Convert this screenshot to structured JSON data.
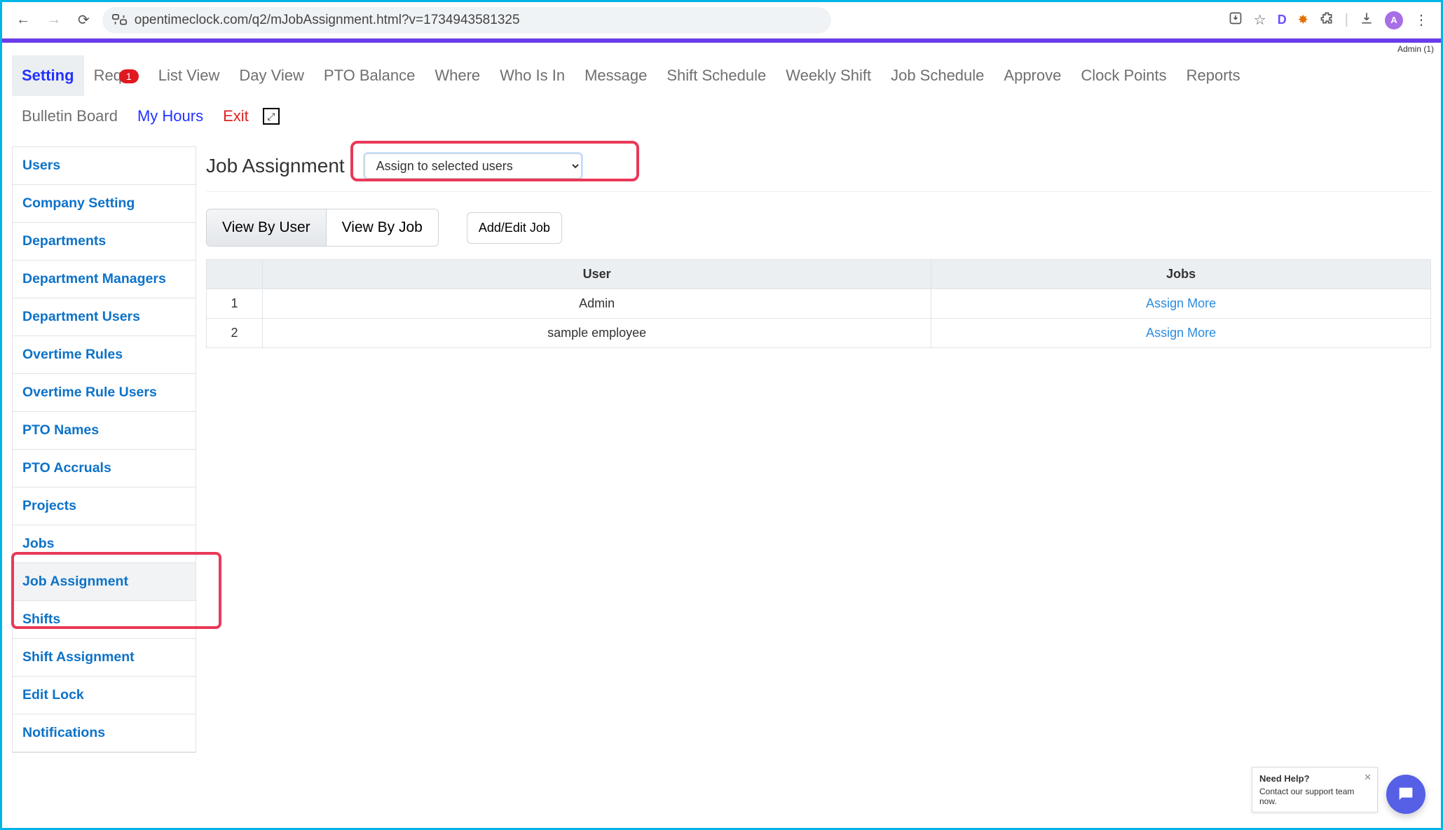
{
  "browser": {
    "url": "opentimeclock.com/q2/mJobAssignment.html?v=1734943581325",
    "avatar_letter": "A"
  },
  "header": {
    "admin_text": "Admin (1)"
  },
  "topnav": {
    "row1": [
      {
        "label": "Setting",
        "active": true
      },
      {
        "label": "Req",
        "badge": "1"
      },
      {
        "label": "List View"
      },
      {
        "label": "Day View"
      },
      {
        "label": "PTO Balance"
      },
      {
        "label": "Where"
      },
      {
        "label": "Who Is In"
      },
      {
        "label": "Message"
      },
      {
        "label": "Shift Schedule"
      },
      {
        "label": "Weekly Shift"
      },
      {
        "label": "Job Schedule"
      },
      {
        "label": "Approve"
      },
      {
        "label": "Clock Points"
      },
      {
        "label": "Reports"
      }
    ],
    "row2": [
      {
        "label": "Bulletin Board"
      },
      {
        "label": "My Hours",
        "blue": true
      },
      {
        "label": "Exit",
        "red": true
      }
    ]
  },
  "sidebar": {
    "items": [
      {
        "label": "Users"
      },
      {
        "label": "Company Setting"
      },
      {
        "label": "Departments"
      },
      {
        "label": "Department Managers"
      },
      {
        "label": "Department Users"
      },
      {
        "label": "Overtime Rules"
      },
      {
        "label": "Overtime Rule Users"
      },
      {
        "label": "PTO Names"
      },
      {
        "label": "PTO Accruals"
      },
      {
        "label": "Projects"
      },
      {
        "label": "Jobs"
      },
      {
        "label": "Job Assignment",
        "active": true
      },
      {
        "label": "Shifts"
      },
      {
        "label": "Shift Assignment"
      },
      {
        "label": "Edit Lock"
      },
      {
        "label": "Notifications"
      }
    ]
  },
  "main": {
    "title": "Job Assignment",
    "select_value": "Assign to selected users",
    "tabs": {
      "view_by_user": "View By User",
      "view_by_job": "View By Job"
    },
    "add_edit_btn": "Add/Edit Job",
    "table": {
      "headers": [
        "",
        "User",
        "Jobs"
      ],
      "rows": [
        {
          "num": "1",
          "user": "Admin",
          "jobs": "Assign More"
        },
        {
          "num": "2",
          "user": "sample employee",
          "jobs": "Assign More"
        }
      ]
    }
  },
  "help": {
    "title": "Need Help?",
    "text": "Contact our support team now."
  }
}
